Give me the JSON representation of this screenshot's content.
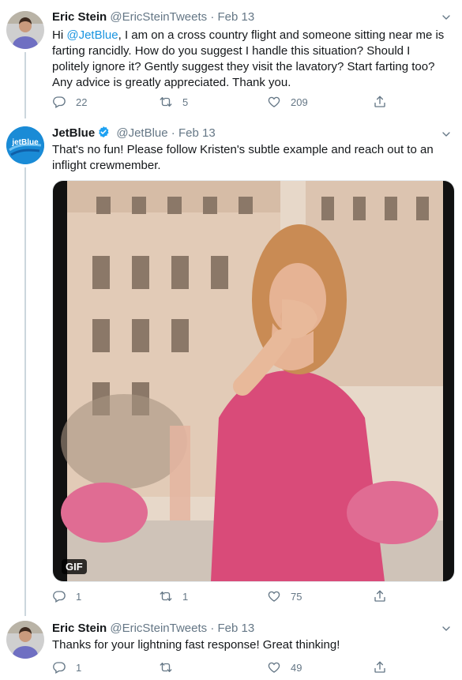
{
  "tweets": [
    {
      "author": "Eric Stein",
      "handle": "@EricSteinTweets",
      "sep": "·",
      "date": "Feb 13",
      "text_before": "Hi ",
      "mention": "@JetBlue",
      "text_after": ", I am on a cross country flight and someone sitting near me is farting rancidly. How do you suggest I handle this situation? Should I politely ignore it? Gently suggest they visit the lavatory? Start farting too? Any advice is greatly appreciated. Thank you.",
      "replies": "22",
      "retweets": "5",
      "likes": "209"
    },
    {
      "author": "JetBlue",
      "handle": "@JetBlue",
      "sep": "·",
      "date": "Feb 13",
      "text": "That's no fun! Please follow Kristen's subtle example and reach out to an inflight crewmember.",
      "avatar_text": "jetBlue",
      "gif_label": "GIF",
      "replies": "1",
      "retweets": "1",
      "likes": "75"
    },
    {
      "author": "Eric Stein",
      "handle": "@EricSteinTweets",
      "sep": "·",
      "date": "Feb 13",
      "text": "Thanks for your lightning fast response! Great thinking!",
      "replies": "1",
      "retweets": "",
      "likes": "49"
    }
  ],
  "colors": {
    "link": "#1b95e0",
    "muted": "#657786",
    "jetblue": "#1a8bd6"
  }
}
